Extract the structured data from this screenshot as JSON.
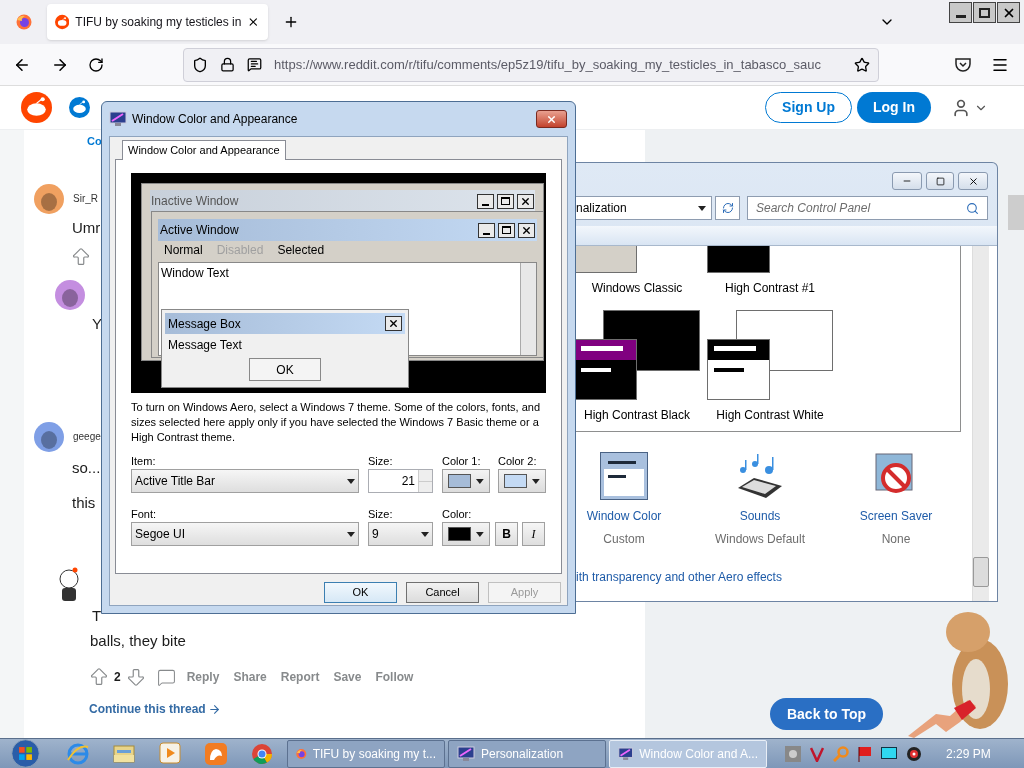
{
  "browser": {
    "tabs": [
      {
        "title": "TIFU by soaking my testicles in",
        "selected": true
      }
    ],
    "url": "https://www.reddit.com/r/tifu/comments/ep5z19/tifu_by_soaking_my_testicles_in_tabasco_sauc"
  },
  "reddit": {
    "header_buttons": [
      {
        "label": "Sign Up",
        "kind": "outline"
      },
      {
        "label": "Log In",
        "kind": "filled"
      }
    ],
    "top_link": "Co",
    "comments": [
      {
        "kind": "avatar",
        "color": "#f0a060",
        "author": "Sir_R",
        "lines": [
          "Umr"
        ]
      },
      {
        "kind": "avatar",
        "color": "#c48ee0",
        "lines": [
          "Y"
        ]
      },
      {
        "kind": "avatar",
        "color": "#7f9fe6",
        "author": "geege",
        "lines": [
          "so...",
          "this"
        ]
      },
      {
        "kind": "snoo",
        "lines": [
          "T",
          "balls, they bite"
        ],
        "votes": "2",
        "actions": [
          "Reply",
          "Share",
          "Report",
          "Save",
          "Follow"
        ],
        "continue": "Continue this thread"
      }
    ],
    "back_to_top": "Back to Top"
  },
  "dialog": {
    "title": "Window Color and Appearance",
    "tabs": [
      {
        "label": "Window Color and Appearance",
        "selected": true
      }
    ],
    "preview": {
      "inactive_title": "Inactive Window",
      "active_title": "Active Window",
      "menu": [
        {
          "label": "Normal",
          "disabled": false
        },
        {
          "label": "Disabled",
          "disabled": true
        },
        {
          "label": "Selected",
          "disabled": false
        }
      ],
      "window_text": "Window Text",
      "message_title": "Message Box",
      "message_text": "Message Text",
      "message_button": "OK"
    },
    "note": "To turn on Windows Aero, select a Windows 7 theme.  Some of the colors, fonts, and sizes selected here apply only if you have selected the Windows 7 Basic theme or a High Contrast theme.",
    "item": {
      "label": "Item:",
      "value": "Active Title Bar"
    },
    "item_size": {
      "label": "Size:",
      "value": "21"
    },
    "color1": {
      "label": "Color 1:",
      "color": "#a6bcd8"
    },
    "color2": {
      "label": "Color 2:",
      "color": "#c4daf4"
    },
    "font": {
      "label": "Font:",
      "value": "Segoe UI"
    },
    "font_size": {
      "label": "Size:",
      "value": "9"
    },
    "font_color": {
      "label": "Color:",
      "color": "#000000"
    },
    "style_buttons": [
      {
        "label": "B",
        "kind": "bold"
      },
      {
        "label": "I",
        "kind": "italic"
      }
    ],
    "buttons": [
      {
        "label": "OK",
        "disabled": false
      },
      {
        "label": "Cancel",
        "disabled": false
      },
      {
        "label": "Apply",
        "disabled": true
      }
    ]
  },
  "personalization": {
    "address": "nalization",
    "search_placeholder": "Search Control Panel",
    "themes": [
      {
        "name": "Windows Classic",
        "kind": "classic"
      },
      {
        "name": "High Contrast #1",
        "kind": "hc1"
      },
      {
        "name": "High Contrast Black",
        "kind": "hc-black"
      },
      {
        "name": "High Contrast White",
        "kind": "hc-white"
      }
    ],
    "settings": [
      {
        "title": "Window Color",
        "value": "Custom",
        "kind": "window-color"
      },
      {
        "title": "Sounds",
        "value": "Windows Default",
        "kind": "sounds"
      },
      {
        "title": "Screen Saver",
        "value": "None",
        "kind": "screen-saver"
      }
    ],
    "link": "ith transparency and other Aero effects"
  },
  "taskbar": {
    "pinned": [
      {
        "kind": "ie"
      },
      {
        "kind": "explorer"
      },
      {
        "kind": "media"
      },
      {
        "kind": "uc"
      },
      {
        "kind": "chrome"
      }
    ],
    "tasks": [
      {
        "label": "TIFU by soaking my t...",
        "kind": "firefox",
        "selected": false
      },
      {
        "label": "Personalization",
        "kind": "control",
        "selected": false
      },
      {
        "label": "Window Color and A...",
        "kind": "control",
        "selected": true
      }
    ],
    "clock": "2:29 PM"
  }
}
